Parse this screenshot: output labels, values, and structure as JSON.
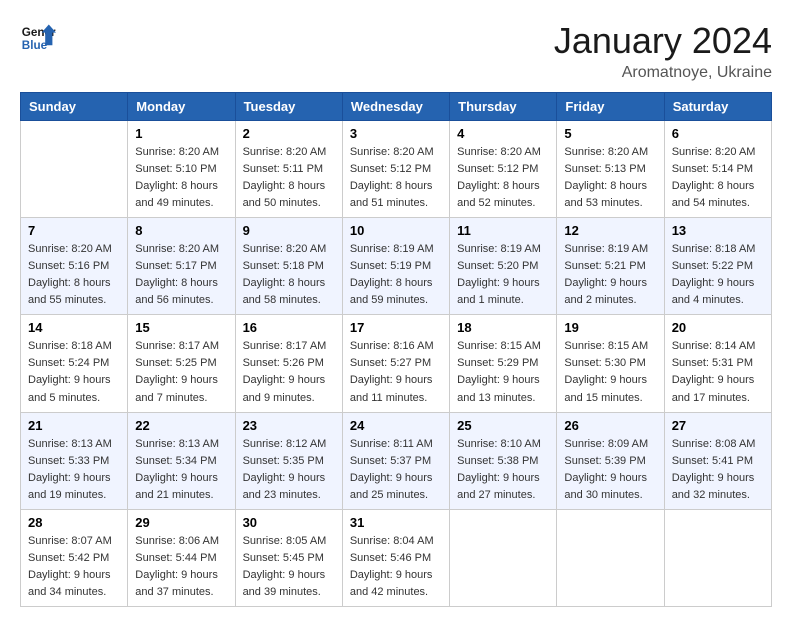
{
  "header": {
    "logo_line1": "General",
    "logo_line2": "Blue",
    "month_title": "January 2024",
    "location": "Aromatnoye, Ukraine"
  },
  "weekdays": [
    "Sunday",
    "Monday",
    "Tuesday",
    "Wednesday",
    "Thursday",
    "Friday",
    "Saturday"
  ],
  "weeks": [
    [
      {
        "day": "",
        "sunrise": "",
        "sunset": "",
        "daylight": ""
      },
      {
        "day": "1",
        "sunrise": "8:20 AM",
        "sunset": "5:10 PM",
        "daylight": "8 hours and 49 minutes."
      },
      {
        "day": "2",
        "sunrise": "8:20 AM",
        "sunset": "5:11 PM",
        "daylight": "8 hours and 50 minutes."
      },
      {
        "day": "3",
        "sunrise": "8:20 AM",
        "sunset": "5:12 PM",
        "daylight": "8 hours and 51 minutes."
      },
      {
        "day": "4",
        "sunrise": "8:20 AM",
        "sunset": "5:12 PM",
        "daylight": "8 hours and 52 minutes."
      },
      {
        "day": "5",
        "sunrise": "8:20 AM",
        "sunset": "5:13 PM",
        "daylight": "8 hours and 53 minutes."
      },
      {
        "day": "6",
        "sunrise": "8:20 AM",
        "sunset": "5:14 PM",
        "daylight": "8 hours and 54 minutes."
      }
    ],
    [
      {
        "day": "7",
        "sunrise": "8:20 AM",
        "sunset": "5:16 PM",
        "daylight": "8 hours and 55 minutes."
      },
      {
        "day": "8",
        "sunrise": "8:20 AM",
        "sunset": "5:17 PM",
        "daylight": "8 hours and 56 minutes."
      },
      {
        "day": "9",
        "sunrise": "8:20 AM",
        "sunset": "5:18 PM",
        "daylight": "8 hours and 58 minutes."
      },
      {
        "day": "10",
        "sunrise": "8:19 AM",
        "sunset": "5:19 PM",
        "daylight": "8 hours and 59 minutes."
      },
      {
        "day": "11",
        "sunrise": "8:19 AM",
        "sunset": "5:20 PM",
        "daylight": "9 hours and 1 minute."
      },
      {
        "day": "12",
        "sunrise": "8:19 AM",
        "sunset": "5:21 PM",
        "daylight": "9 hours and 2 minutes."
      },
      {
        "day": "13",
        "sunrise": "8:18 AM",
        "sunset": "5:22 PM",
        "daylight": "9 hours and 4 minutes."
      }
    ],
    [
      {
        "day": "14",
        "sunrise": "8:18 AM",
        "sunset": "5:24 PM",
        "daylight": "9 hours and 5 minutes."
      },
      {
        "day": "15",
        "sunrise": "8:17 AM",
        "sunset": "5:25 PM",
        "daylight": "9 hours and 7 minutes."
      },
      {
        "day": "16",
        "sunrise": "8:17 AM",
        "sunset": "5:26 PM",
        "daylight": "9 hours and 9 minutes."
      },
      {
        "day": "17",
        "sunrise": "8:16 AM",
        "sunset": "5:27 PM",
        "daylight": "9 hours and 11 minutes."
      },
      {
        "day": "18",
        "sunrise": "8:15 AM",
        "sunset": "5:29 PM",
        "daylight": "9 hours and 13 minutes."
      },
      {
        "day": "19",
        "sunrise": "8:15 AM",
        "sunset": "5:30 PM",
        "daylight": "9 hours and 15 minutes."
      },
      {
        "day": "20",
        "sunrise": "8:14 AM",
        "sunset": "5:31 PM",
        "daylight": "9 hours and 17 minutes."
      }
    ],
    [
      {
        "day": "21",
        "sunrise": "8:13 AM",
        "sunset": "5:33 PM",
        "daylight": "9 hours and 19 minutes."
      },
      {
        "day": "22",
        "sunrise": "8:13 AM",
        "sunset": "5:34 PM",
        "daylight": "9 hours and 21 minutes."
      },
      {
        "day": "23",
        "sunrise": "8:12 AM",
        "sunset": "5:35 PM",
        "daylight": "9 hours and 23 minutes."
      },
      {
        "day": "24",
        "sunrise": "8:11 AM",
        "sunset": "5:37 PM",
        "daylight": "9 hours and 25 minutes."
      },
      {
        "day": "25",
        "sunrise": "8:10 AM",
        "sunset": "5:38 PM",
        "daylight": "9 hours and 27 minutes."
      },
      {
        "day": "26",
        "sunrise": "8:09 AM",
        "sunset": "5:39 PM",
        "daylight": "9 hours and 30 minutes."
      },
      {
        "day": "27",
        "sunrise": "8:08 AM",
        "sunset": "5:41 PM",
        "daylight": "9 hours and 32 minutes."
      }
    ],
    [
      {
        "day": "28",
        "sunrise": "8:07 AM",
        "sunset": "5:42 PM",
        "daylight": "9 hours and 34 minutes."
      },
      {
        "day": "29",
        "sunrise": "8:06 AM",
        "sunset": "5:44 PM",
        "daylight": "9 hours and 37 minutes."
      },
      {
        "day": "30",
        "sunrise": "8:05 AM",
        "sunset": "5:45 PM",
        "daylight": "9 hours and 39 minutes."
      },
      {
        "day": "31",
        "sunrise": "8:04 AM",
        "sunset": "5:46 PM",
        "daylight": "9 hours and 42 minutes."
      },
      {
        "day": "",
        "sunrise": "",
        "sunset": "",
        "daylight": ""
      },
      {
        "day": "",
        "sunrise": "",
        "sunset": "",
        "daylight": ""
      },
      {
        "day": "",
        "sunrise": "",
        "sunset": "",
        "daylight": ""
      }
    ]
  ],
  "labels": {
    "sunrise_prefix": "Sunrise: ",
    "sunset_prefix": "Sunset: ",
    "daylight_prefix": "Daylight: "
  }
}
